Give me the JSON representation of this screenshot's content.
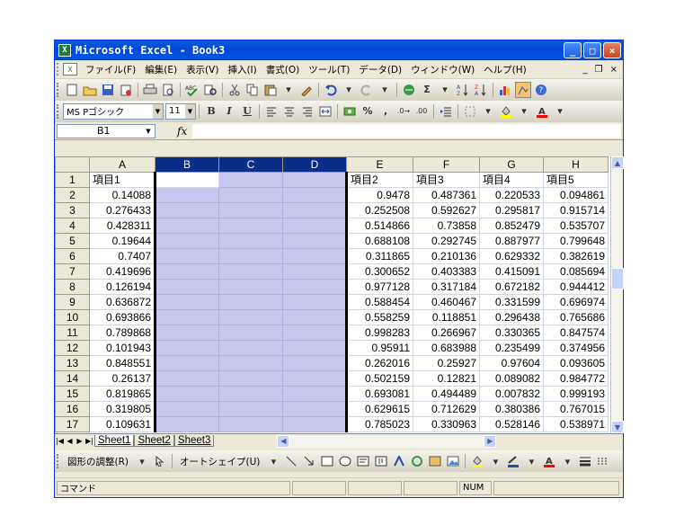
{
  "window": {
    "app_icon": "excel-icon",
    "title": "Microsoft Excel - Book3",
    "min_label": "_",
    "max_label": "□",
    "close_label": "×"
  },
  "menu": {
    "items": [
      "ファイル(F)",
      "編集(E)",
      "表示(V)",
      "挿入(I)",
      "書式(O)",
      "ツール(T)",
      "データ(D)",
      "ウィンドウ(W)",
      "ヘルプ(H)"
    ],
    "doc_min": "_",
    "doc_restore": "❐",
    "doc_close": "×"
  },
  "format_toolbar": {
    "font_name": "MS Pゴシック",
    "font_size": "11",
    "bold": "B",
    "italic": "I",
    "underline": "U",
    "percent": "%",
    "comma": ","
  },
  "formula_bar": {
    "name_box": "B1",
    "fx_label": "fx",
    "formula": ""
  },
  "grid": {
    "columns": [
      "A",
      "B",
      "C",
      "D",
      "E",
      "F",
      "G",
      "H"
    ],
    "row_numbers": [
      "1",
      "2",
      "3",
      "4",
      "5",
      "6",
      "7",
      "8",
      "9",
      "10",
      "11",
      "12",
      "13",
      "14",
      "15",
      "16",
      "17"
    ],
    "rows": [
      [
        "項目1",
        "",
        "",
        "",
        "項目2",
        "項目3",
        "項目4",
        "項目5"
      ],
      [
        "0.14088",
        "",
        "",
        "",
        "0.9478",
        "0.487361",
        "0.220533",
        "0.094861"
      ],
      [
        "0.276433",
        "",
        "",
        "",
        "0.252508",
        "0.592627",
        "0.295817",
        "0.915714"
      ],
      [
        "0.428311",
        "",
        "",
        "",
        "0.514866",
        "0.73858",
        "0.852479",
        "0.535707"
      ],
      [
        "0.19644",
        "",
        "",
        "",
        "0.688108",
        "0.292745",
        "0.887977",
        "0.799648"
      ],
      [
        "0.7407",
        "",
        "",
        "",
        "0.311865",
        "0.210136",
        "0.629332",
        "0.382619"
      ],
      [
        "0.419696",
        "",
        "",
        "",
        "0.300652",
        "0.403383",
        "0.415091",
        "0.085694"
      ],
      [
        "0.126194",
        "",
        "",
        "",
        "0.977128",
        "0.317184",
        "0.672182",
        "0.944412"
      ],
      [
        "0.636872",
        "",
        "",
        "",
        "0.588454",
        "0.460467",
        "0.331599",
        "0.696974"
      ],
      [
        "0.693866",
        "",
        "",
        "",
        "0.558259",
        "0.118851",
        "0.296438",
        "0.765686"
      ],
      [
        "0.789868",
        "",
        "",
        "",
        "0.998283",
        "0.266967",
        "0.330365",
        "0.847574"
      ],
      [
        "0.101943",
        "",
        "",
        "",
        "0.95911",
        "0.683988",
        "0.235499",
        "0.374956"
      ],
      [
        "0.848551",
        "",
        "",
        "",
        "0.262016",
        "0.25927",
        "0.97604",
        "0.093605"
      ],
      [
        "0.26137",
        "",
        "",
        "",
        "0.502159",
        "0.12821",
        "0.089082",
        "0.984772"
      ],
      [
        "0.819865",
        "",
        "",
        "",
        "0.693081",
        "0.494489",
        "0.007832",
        "0.999193"
      ],
      [
        "0.319805",
        "",
        "",
        "",
        "0.629615",
        "0.712629",
        "0.380386",
        "0.767015"
      ],
      [
        "0.109631",
        "",
        "",
        "",
        "0.785023",
        "0.330963",
        "0.528146",
        "0.538971"
      ]
    ]
  },
  "sheets": {
    "tabs": [
      "Sheet1",
      "Sheet2",
      "Sheet3"
    ],
    "active": "Sheet1"
  },
  "drawing_toolbar": {
    "draw_menu": "図形の調整(R)",
    "autoshapes_menu": "オートシェイプ(U)"
  },
  "status": {
    "mode": "コマンド",
    "num": "NUM"
  }
}
